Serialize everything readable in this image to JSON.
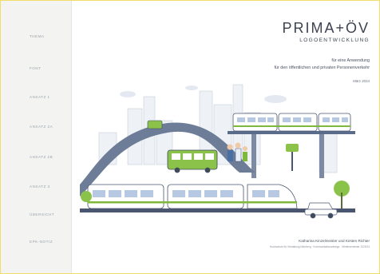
{
  "nav": {
    "items": [
      "THEMA",
      "FONT",
      "ANSATZ 1",
      "ANSATZ 2A",
      "ANSATZ 2B",
      "ANSATZ 3",
      "ÜBERSICHT",
      "EPK-NOTIZ"
    ]
  },
  "header": {
    "title": "PRIMA+ÖV",
    "subtitle": "LOGOENTWICKLUNG",
    "desc_line1": "für eine Anwendung",
    "desc_line2": "für den öffentlichen und privaten Personenverkehr",
    "date": "März 2024"
  },
  "footer": {
    "credits": "Katharina Kinzelmeister und Kirsten Richter",
    "fine_print": "Hochschule für Gestaltung Nürnberg · Kommunikationsdesign · Wintersemester 2023/24"
  },
  "colors": {
    "frame_border": "#f2dc6a",
    "sidebar_bg": "#f3f3f1",
    "accent_green": "#7fb83a",
    "accent_blue": "#4a6fa5",
    "text_dark": "#3b4350"
  }
}
